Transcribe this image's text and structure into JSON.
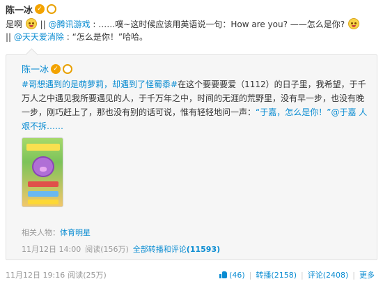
{
  "post": {
    "author": "陈一冰",
    "text_prefix": "是啊",
    "sep1": " || ",
    "mention1": "@腾讯游戏",
    "text1": ": ……噗~这时候应该用英语说一句：How are you? ——怎么是你?",
    "sep2": "|| ",
    "mention2": "@天天爱消除",
    "text2": ": “怎么是你！”哈哈。"
  },
  "repost": {
    "author": "陈一冰",
    "tag1": "#哥想遇到的是萌萝莉，却遇到了怪蜀黍#",
    "text1": "在这个要要要爱（1112）的日子里，我希望，于千万人之中遇见我所要遇见的人，于千万年之中，时间的无涯的荒野里，没有早一步，也没有晚一步，刚巧赶上了，那也没有别的话可说，惟有轻轻地问一声：",
    "quote": "“于嘉，怎么是你！”",
    "mention": "@于嘉",
    "text2": " 人艰不拆……",
    "related_label": "相关人物：",
    "related_link": "体育明星",
    "time": "11月12日 14:00",
    "reads": "阅读(156万)",
    "all_reposts_label": "全部转播和评论",
    "all_reposts_count": "(11593)"
  },
  "footer": {
    "time": "11月12日 19:16",
    "reads": "阅读(25万)",
    "likes": "(46)",
    "repost": "转播(2158)",
    "comment": "评论(2408)",
    "more": "更多"
  },
  "colors": {
    "link": "#0a8cd2",
    "meta": "#999999",
    "box_bg": "#f6f6f6"
  }
}
